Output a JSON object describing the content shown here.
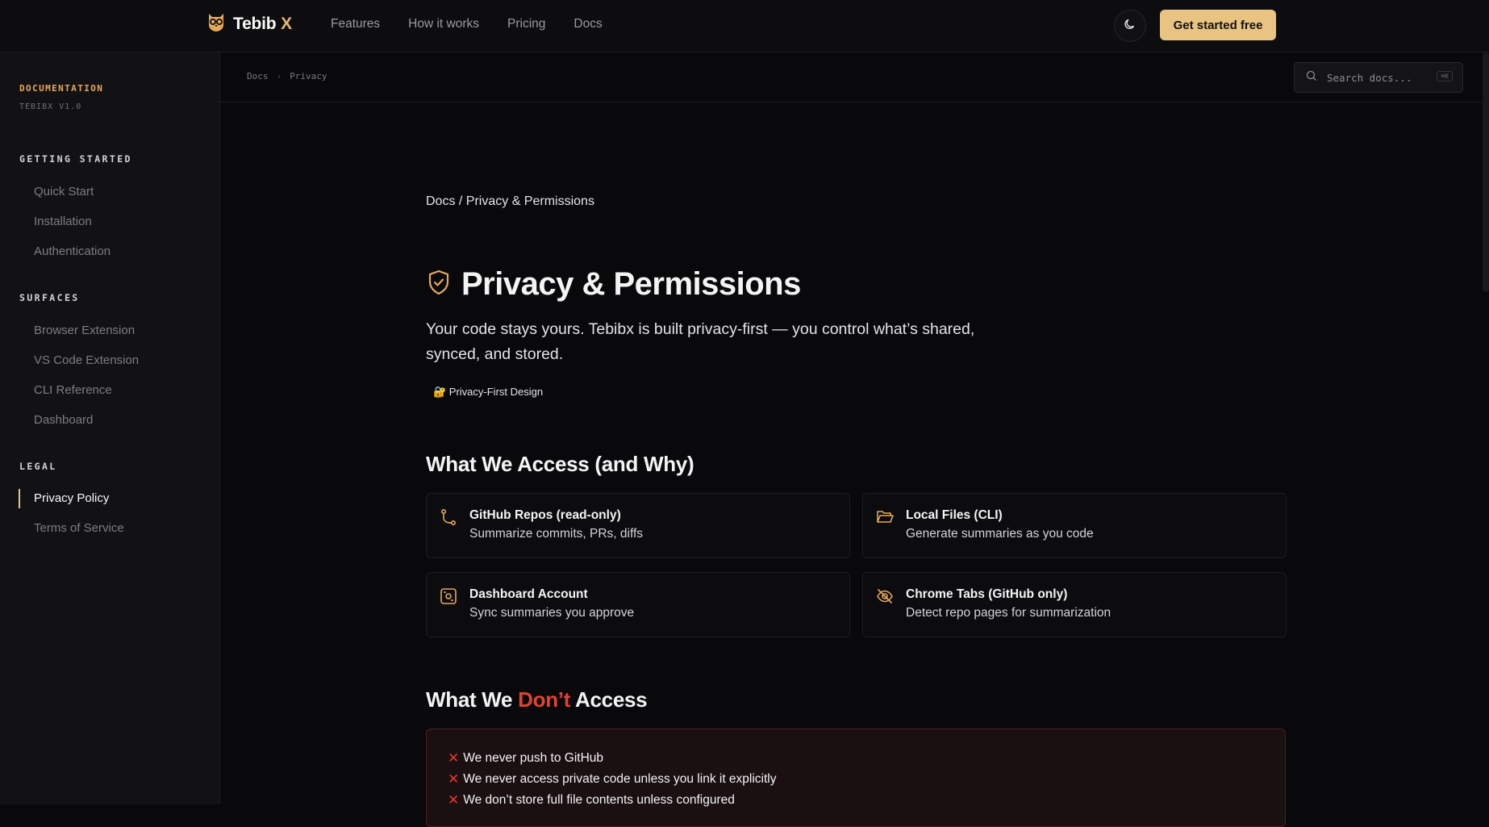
{
  "nav": {
    "brand": "Tebib",
    "brand_suffix": "X",
    "links": [
      "Features",
      "How it works",
      "Pricing",
      "Docs"
    ],
    "cta": "Get started free"
  },
  "sidebar": {
    "title": "DOCUMENTATION",
    "version": "TEBIBX V1.0",
    "sections": [
      {
        "label": "GETTING STARTED",
        "items": [
          "Quick Start",
          "Installation",
          "Authentication"
        ]
      },
      {
        "label": "SURFACES",
        "items": [
          "Browser Extension",
          "VS Code Extension",
          "CLI Reference",
          "Dashboard"
        ]
      },
      {
        "label": "LEGAL",
        "items": [
          "Privacy Policy",
          "Terms of Service"
        ]
      }
    ],
    "active_item": "Privacy Policy"
  },
  "crumbbar": {
    "crumbs": [
      "Docs",
      "Privacy"
    ],
    "separator": "›",
    "search_placeholder": "Search docs...",
    "search_shortcut": "⌘K"
  },
  "main": {
    "breadcrumb": "Docs / Privacy & Permissions",
    "title": "Privacy & Permissions",
    "lead": "Your code stays yours. Tebibx is built privacy-first — you control what’s shared, synced, and stored.",
    "badge": "🔐 Privacy-First Design",
    "access_heading": "What We Access (and Why)",
    "access_cards": [
      {
        "icon": "git-branch-icon",
        "title": "GitHub Repos (read-only)",
        "desc": "Summarize commits, PRs, diffs"
      },
      {
        "icon": "folder-open-icon",
        "title": "Local Files (CLI)",
        "desc": "Generate summaries as you code"
      },
      {
        "icon": "dashboard-icon",
        "title": "Dashboard Account",
        "desc": "Sync summaries you approve"
      },
      {
        "icon": "eye-off-icon",
        "title": "Chrome Tabs (GitHub only)",
        "desc": "Detect repo pages for summarization"
      }
    ],
    "deny_heading_pre": "What We",
    "deny_heading_em": "Don’t",
    "deny_heading_post": "Access",
    "deny_items": [
      "We never push to GitHub",
      "We never access private code unless you link it explicitly",
      "We don’t store full file contents unless configured"
    ]
  },
  "colors": {
    "accent": "#e8c382",
    "accent_icon": "#e7a85a",
    "danger": "#e2432f",
    "background": "#09090b"
  }
}
